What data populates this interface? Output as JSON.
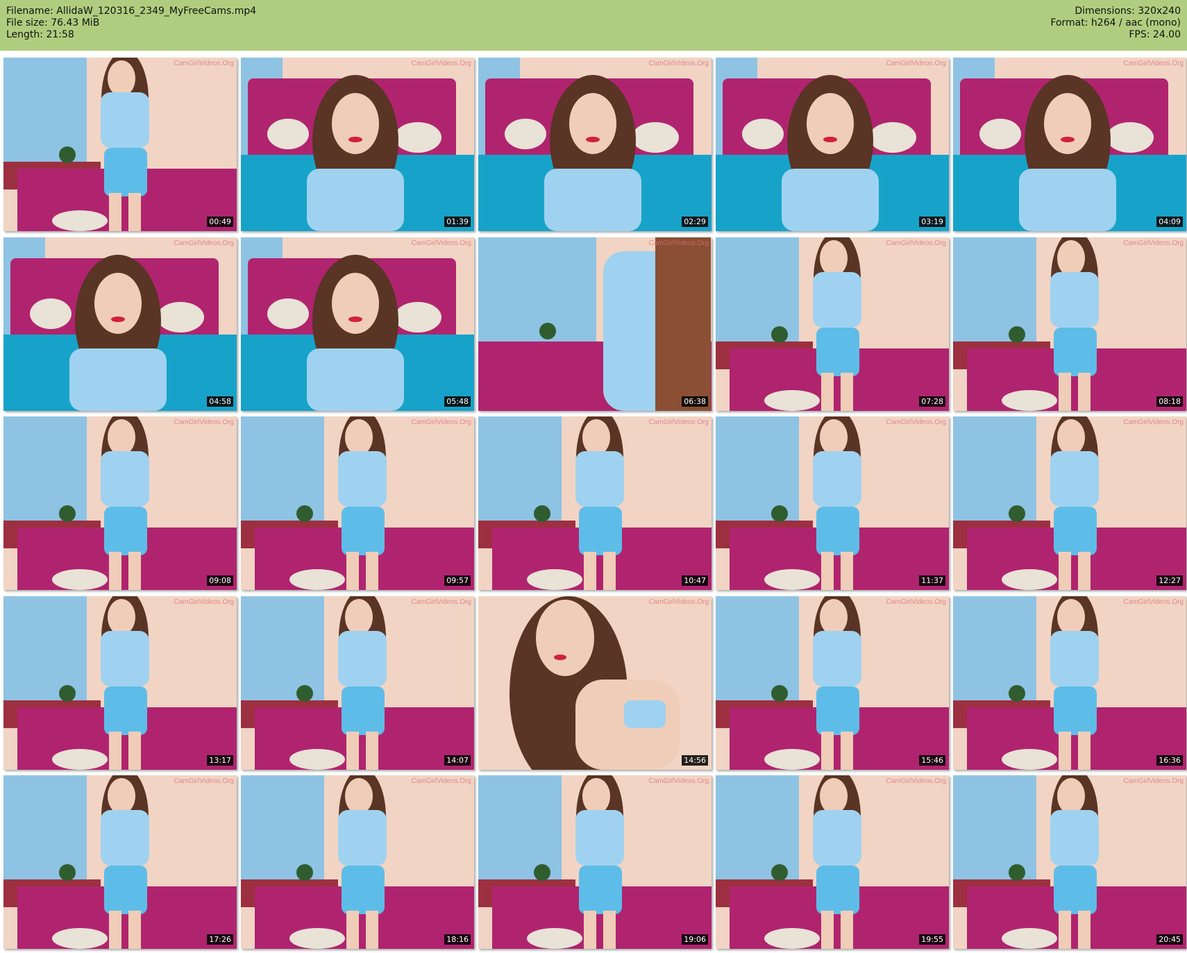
{
  "header": {
    "filename_label": "Filename: AllidaW_120316_2349_MyFreeCams.mp4",
    "filesize_label": "File size: 76.43 MiB",
    "length_label": "Length: 21:58",
    "dimensions_label": "Dimensions: 320x240",
    "format_label": "Format: h264 / aac (mono)",
    "fps_label": "FPS: 24.00"
  },
  "watermark": "CamGirlVideos.Org",
  "thumbnails": [
    {
      "time": "00:49",
      "scene": "standing"
    },
    {
      "time": "01:39",
      "scene": "closeup"
    },
    {
      "time": "02:29",
      "scene": "closeup"
    },
    {
      "time": "03:19",
      "scene": "closeup"
    },
    {
      "time": "04:09",
      "scene": "closeup"
    },
    {
      "time": "04:58",
      "scene": "closeup"
    },
    {
      "time": "05:48",
      "scene": "closeup"
    },
    {
      "time": "06:38",
      "scene": "side"
    },
    {
      "time": "07:28",
      "scene": "standing"
    },
    {
      "time": "08:18",
      "scene": "standing"
    },
    {
      "time": "09:08",
      "scene": "standing"
    },
    {
      "time": "09:57",
      "scene": "standing"
    },
    {
      "time": "10:47",
      "scene": "standing"
    },
    {
      "time": "11:37",
      "scene": "standing"
    },
    {
      "time": "12:27",
      "scene": "standing"
    },
    {
      "time": "13:17",
      "scene": "standing"
    },
    {
      "time": "14:07",
      "scene": "standing"
    },
    {
      "time": "14:56",
      "scene": "face"
    },
    {
      "time": "15:46",
      "scene": "standing"
    },
    {
      "time": "16:36",
      "scene": "standing"
    },
    {
      "time": "17:26",
      "scene": "standing"
    },
    {
      "time": "18:16",
      "scene": "standing"
    },
    {
      "time": "19:06",
      "scene": "standing"
    },
    {
      "time": "19:55",
      "scene": "standing"
    },
    {
      "time": "20:45",
      "scene": "standing"
    }
  ],
  "colors": {
    "header_bg": "#b0cd7f",
    "wall_blue": "#8fc3e3",
    "wall_peach": "#f1d4c4",
    "headboard_magenta": "#b0246f",
    "bed_teal": "#17a3c9",
    "dress_blue": "#9fd2f0",
    "hair_brown": "#5a3424",
    "skin": "#f0cdb8"
  }
}
